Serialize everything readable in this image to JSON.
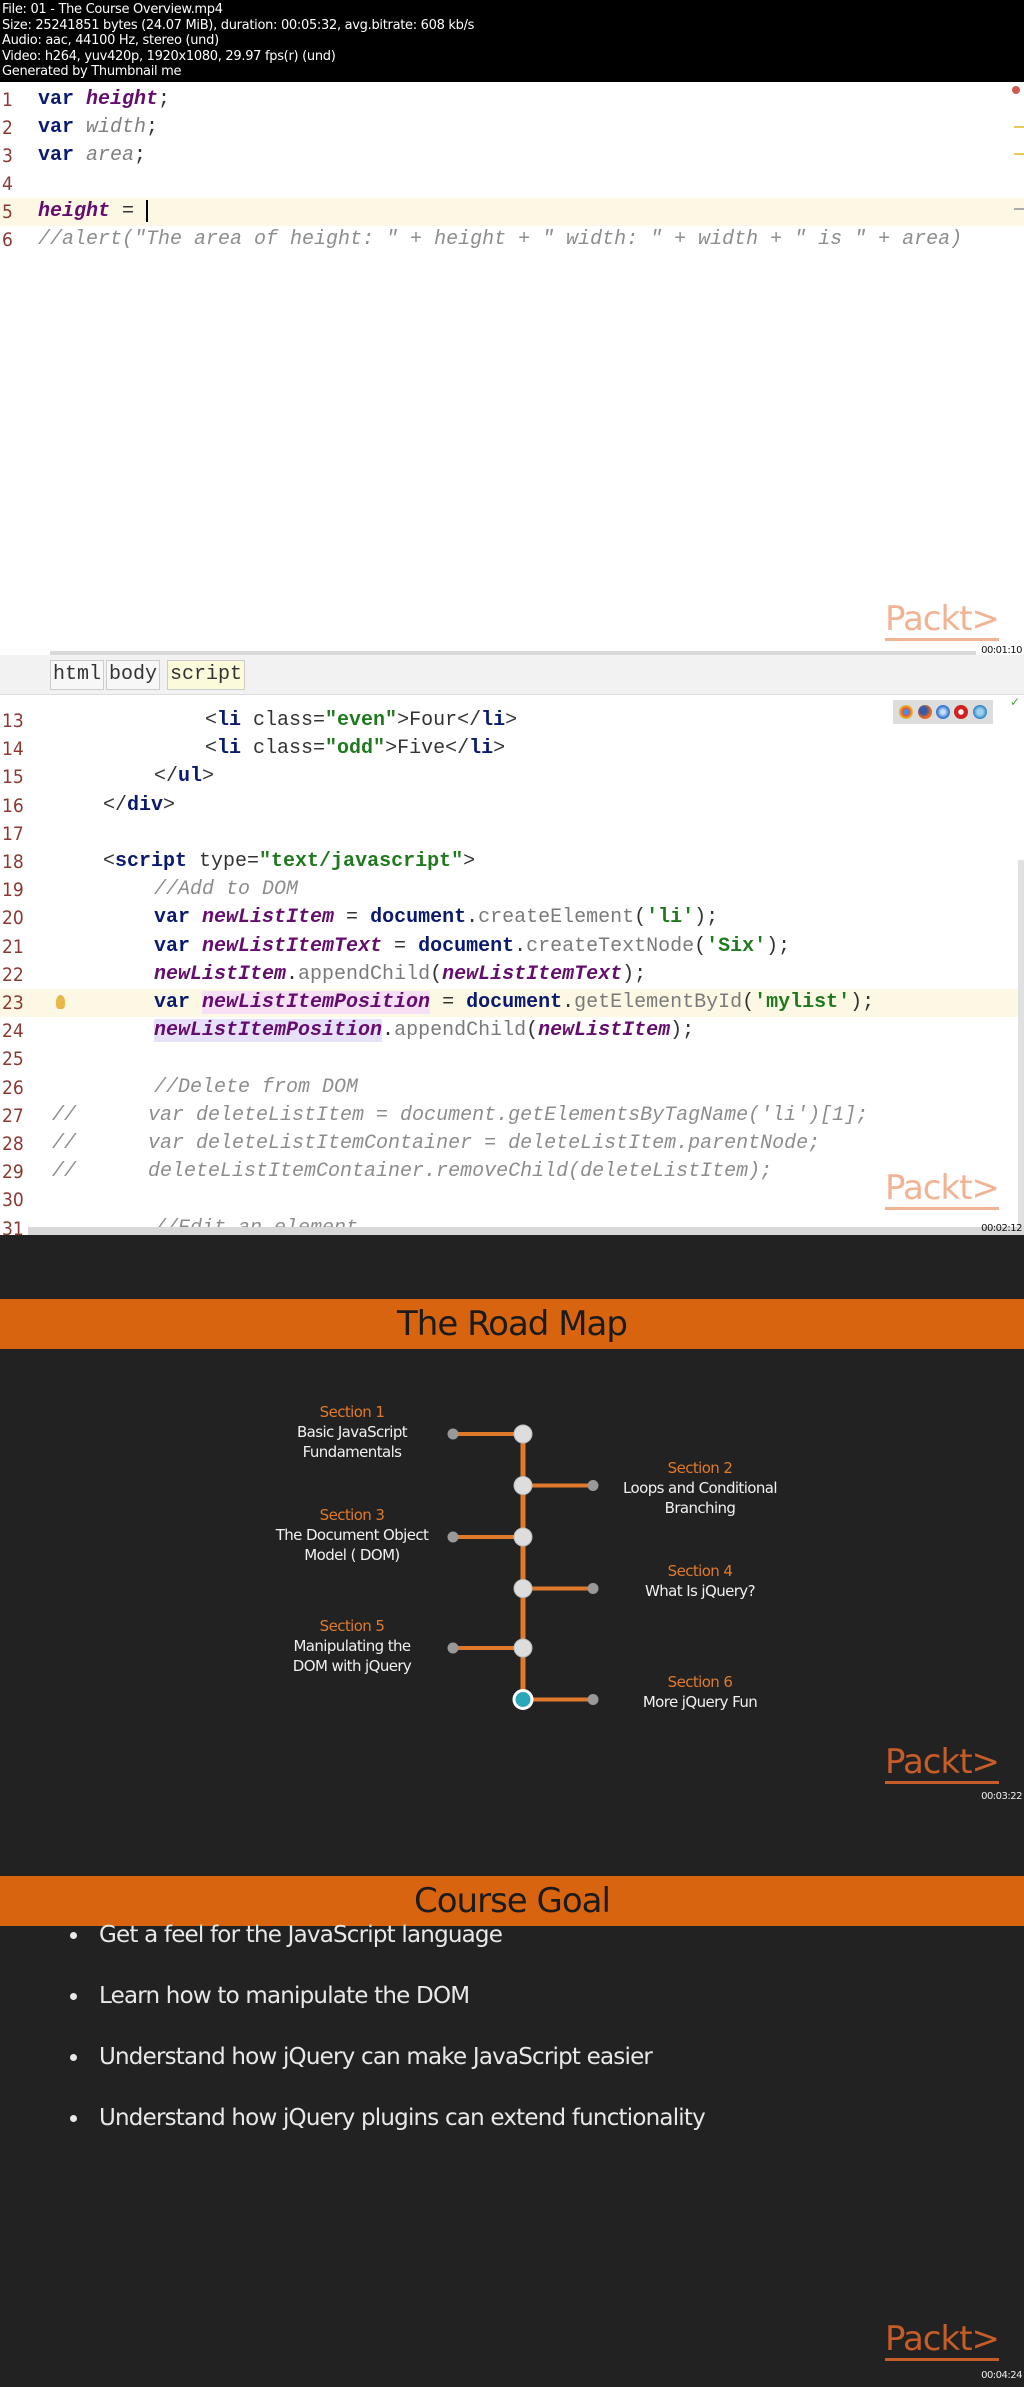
{
  "file_info": {
    "lines": [
      "File: 01 - The Course Overview.mp4",
      "Size: 25241851 bytes (24.07 MiB), duration: 00:05:32, avg.bitrate: 608 kb/s",
      "Audio: aac, 44100 Hz, stereo (und)",
      "Video: h264, yuv420p, 1920x1080, 29.97 fps(r) (und)",
      "Generated by Thumbnail me"
    ]
  },
  "frames": [
    {
      "timestamp": "00:01:10",
      "logo": "Packt>",
      "editor": {
        "lines": [
          {
            "num": "1",
            "tokens": [
              {
                "t": "var ",
                "c": "kw"
              },
              {
                "t": "height",
                "c": "var"
              },
              {
                "t": ";",
                "c": "plain"
              }
            ]
          },
          {
            "num": "2",
            "tokens": [
              {
                "t": "var ",
                "c": "kw"
              },
              {
                "t": "width",
                "c": "ivar"
              },
              {
                "t": ";",
                "c": "plain"
              }
            ]
          },
          {
            "num": "3",
            "tokens": [
              {
                "t": "var ",
                "c": "kw"
              },
              {
                "t": "area",
                "c": "ivar"
              },
              {
                "t": ";",
                "c": "plain"
              }
            ]
          },
          {
            "num": "4",
            "tokens": []
          },
          {
            "num": "5",
            "tokens": [
              {
                "t": "height",
                "c": "var"
              },
              {
                "t": " = ",
                "c": "plain"
              }
            ],
            "current": true,
            "caret": true
          },
          {
            "num": "6",
            "tokens": [
              {
                "t": "//alert(\"The area of height: \" + height + \" width: \" + width + \" is \" + area)",
                "c": "cmt"
              }
            ]
          }
        ]
      }
    },
    {
      "timestamp": "00:02:12",
      "logo": "Packt>",
      "breadcrumbs": [
        "html",
        "body",
        "script"
      ],
      "browser_icons": [
        "chrome-icon",
        "firefox-icon",
        "safari-icon",
        "opera-icon",
        "ie-icon"
      ],
      "editor": {
        "lines": [
          {
            "num": "13",
            "indent": 3,
            "tokens": [
              {
                "t": "<",
                "c": "plain"
              },
              {
                "t": "li",
                "c": "tag"
              },
              {
                "t": " class=",
                "c": "plain"
              },
              {
                "t": "\"even\"",
                "c": "str"
              },
              {
                "t": ">Four</",
                "c": "plain"
              },
              {
                "t": "li",
                "c": "tag"
              },
              {
                "t": ">",
                "c": "plain"
              }
            ]
          },
          {
            "num": "14",
            "indent": 3,
            "tokens": [
              {
                "t": "<",
                "c": "plain"
              },
              {
                "t": "li",
                "c": "tag"
              },
              {
                "t": " class=",
                "c": "plain"
              },
              {
                "t": "\"odd\"",
                "c": "str"
              },
              {
                "t": ">Five</",
                "c": "plain"
              },
              {
                "t": "li",
                "c": "tag"
              },
              {
                "t": ">",
                "c": "plain"
              }
            ]
          },
          {
            "num": "15",
            "indent": 2,
            "tokens": [
              {
                "t": "</",
                "c": "plain"
              },
              {
                "t": "ul",
                "c": "tag"
              },
              {
                "t": ">",
                "c": "plain"
              }
            ]
          },
          {
            "num": "16",
            "indent": 1,
            "tokens": [
              {
                "t": "</",
                "c": "plain"
              },
              {
                "t": "div",
                "c": "tag"
              },
              {
                "t": ">",
                "c": "plain"
              }
            ]
          },
          {
            "num": "17",
            "indent": 0,
            "tokens": []
          },
          {
            "num": "18",
            "indent": 1,
            "tokens": [
              {
                "t": "<",
                "c": "plain"
              },
              {
                "t": "script",
                "c": "tag"
              },
              {
                "t": " type=",
                "c": "plain"
              },
              {
                "t": "\"text/javascript\"",
                "c": "str"
              },
              {
                "t": ">",
                "c": "plain"
              }
            ]
          },
          {
            "num": "19",
            "indent": 2,
            "tokens": [
              {
                "t": "//Add to DOM",
                "c": "cmt"
              }
            ]
          },
          {
            "num": "20",
            "indent": 2,
            "tokens": [
              {
                "t": "var ",
                "c": "kw"
              },
              {
                "t": "newListItem",
                "c": "var"
              },
              {
                "t": " = ",
                "c": "plain"
              },
              {
                "t": "document",
                "c": "kw"
              },
              {
                "t": ".",
                "c": "plain"
              },
              {
                "t": "createElement",
                "c": "meth"
              },
              {
                "t": "(",
                "c": "plain"
              },
              {
                "t": "'li'",
                "c": "str"
              },
              {
                "t": ");",
                "c": "plain"
              }
            ]
          },
          {
            "num": "21",
            "indent": 2,
            "tokens": [
              {
                "t": "var ",
                "c": "kw"
              },
              {
                "t": "newListItemText",
                "c": "var"
              },
              {
                "t": " = ",
                "c": "plain"
              },
              {
                "t": "document",
                "c": "kw"
              },
              {
                "t": ".",
                "c": "plain"
              },
              {
                "t": "createTextNode",
                "c": "meth"
              },
              {
                "t": "(",
                "c": "plain"
              },
              {
                "t": "'Six'",
                "c": "str"
              },
              {
                "t": ");",
                "c": "plain"
              }
            ]
          },
          {
            "num": "22",
            "indent": 2,
            "tokens": [
              {
                "t": "newListItem",
                "c": "var"
              },
              {
                "t": ".",
                "c": "plain"
              },
              {
                "t": "appendChild",
                "c": "meth"
              },
              {
                "t": "(",
                "c": "plain"
              },
              {
                "t": "newListItemText",
                "c": "var"
              },
              {
                "t": ");",
                "c": "plain"
              }
            ]
          },
          {
            "num": "23",
            "indent": 2,
            "current": true,
            "bulb": true,
            "tokens": [
              {
                "t": "var ",
                "c": "kw"
              },
              {
                "t": "newListItemPosition",
                "c": "var hl-var"
              },
              {
                "t": " = ",
                "c": "plain"
              },
              {
                "t": "document",
                "c": "kw"
              },
              {
                "t": ".",
                "c": "plain"
              },
              {
                "t": "getElementById",
                "c": "meth"
              },
              {
                "t": "(",
                "c": "plain"
              },
              {
                "t": "'mylist'",
                "c": "str"
              },
              {
                "t": ");",
                "c": "plain"
              }
            ]
          },
          {
            "num": "24",
            "indent": 2,
            "tokens": [
              {
                "t": "newListItemPosition",
                "c": "var hl-var2"
              },
              {
                "t": ".",
                "c": "plain"
              },
              {
                "t": "appendChild",
                "c": "meth"
              },
              {
                "t": "(",
                "c": "plain"
              },
              {
                "t": "newListItem",
                "c": "var"
              },
              {
                "t": ");",
                "c": "plain"
              }
            ]
          },
          {
            "num": "25",
            "indent": 0,
            "tokens": []
          },
          {
            "num": "26",
            "indent": 2,
            "tokens": [
              {
                "t": "//Delete from DOM",
                "c": "cmt"
              }
            ]
          },
          {
            "num": "27",
            "indent": 0,
            "tokens": [
              {
                "t": "//      var deleteListItem = document.getElementsByTagName('li')[1];",
                "c": "cmt"
              }
            ]
          },
          {
            "num": "28",
            "indent": 0,
            "tokens": [
              {
                "t": "//      var deleteListItemContainer = deleteListItem.parentNode;",
                "c": "cmt"
              }
            ]
          },
          {
            "num": "29",
            "indent": 0,
            "tokens": [
              {
                "t": "//      deleteListItemContainer.removeChild(deleteListItem);",
                "c": "cmt"
              }
            ]
          },
          {
            "num": "30",
            "indent": 0,
            "tokens": []
          },
          {
            "num": "31",
            "indent": 2,
            "tokens": [
              {
                "t": "//Edit an element",
                "c": "cmt"
              }
            ]
          }
        ]
      }
    },
    {
      "timestamp": "00:03:22",
      "logo": "Packt>",
      "title": "The Road Map",
      "sections": [
        {
          "label": "Section 1",
          "name": [
            "Basic JavaScript",
            "Fundamentals"
          ],
          "side": "left"
        },
        {
          "label": "Section 2",
          "name": [
            "Loops and Conditional",
            "Branching"
          ],
          "side": "right"
        },
        {
          "label": "Section 3",
          "name": [
            "The Document Object",
            "Model ( DOM)"
          ],
          "side": "left"
        },
        {
          "label": "Section 4",
          "name": [
            "What Is jQuery?"
          ],
          "side": "right"
        },
        {
          "label": "Section 5",
          "name": [
            "Manipulating the",
            "DOM with jQuery"
          ],
          "side": "left"
        },
        {
          "label": "Section 6",
          "name": [
            "More jQuery Fun"
          ],
          "side": "right",
          "current": true
        }
      ],
      "colors": {
        "accent": "#e07a2a",
        "banner": "#d9640f",
        "background": "#222222",
        "current_node": "#2aa7b8"
      }
    },
    {
      "timestamp": "00:04:24",
      "logo": "Packt>",
      "title": "Course Goal",
      "bullets": [
        "Get a feel for the JavaScript language",
        "Learn how to manipulate the DOM",
        "Understand how jQuery can make JavaScript easier",
        "Understand how jQuery plugins can extend functionality"
      ]
    }
  ]
}
